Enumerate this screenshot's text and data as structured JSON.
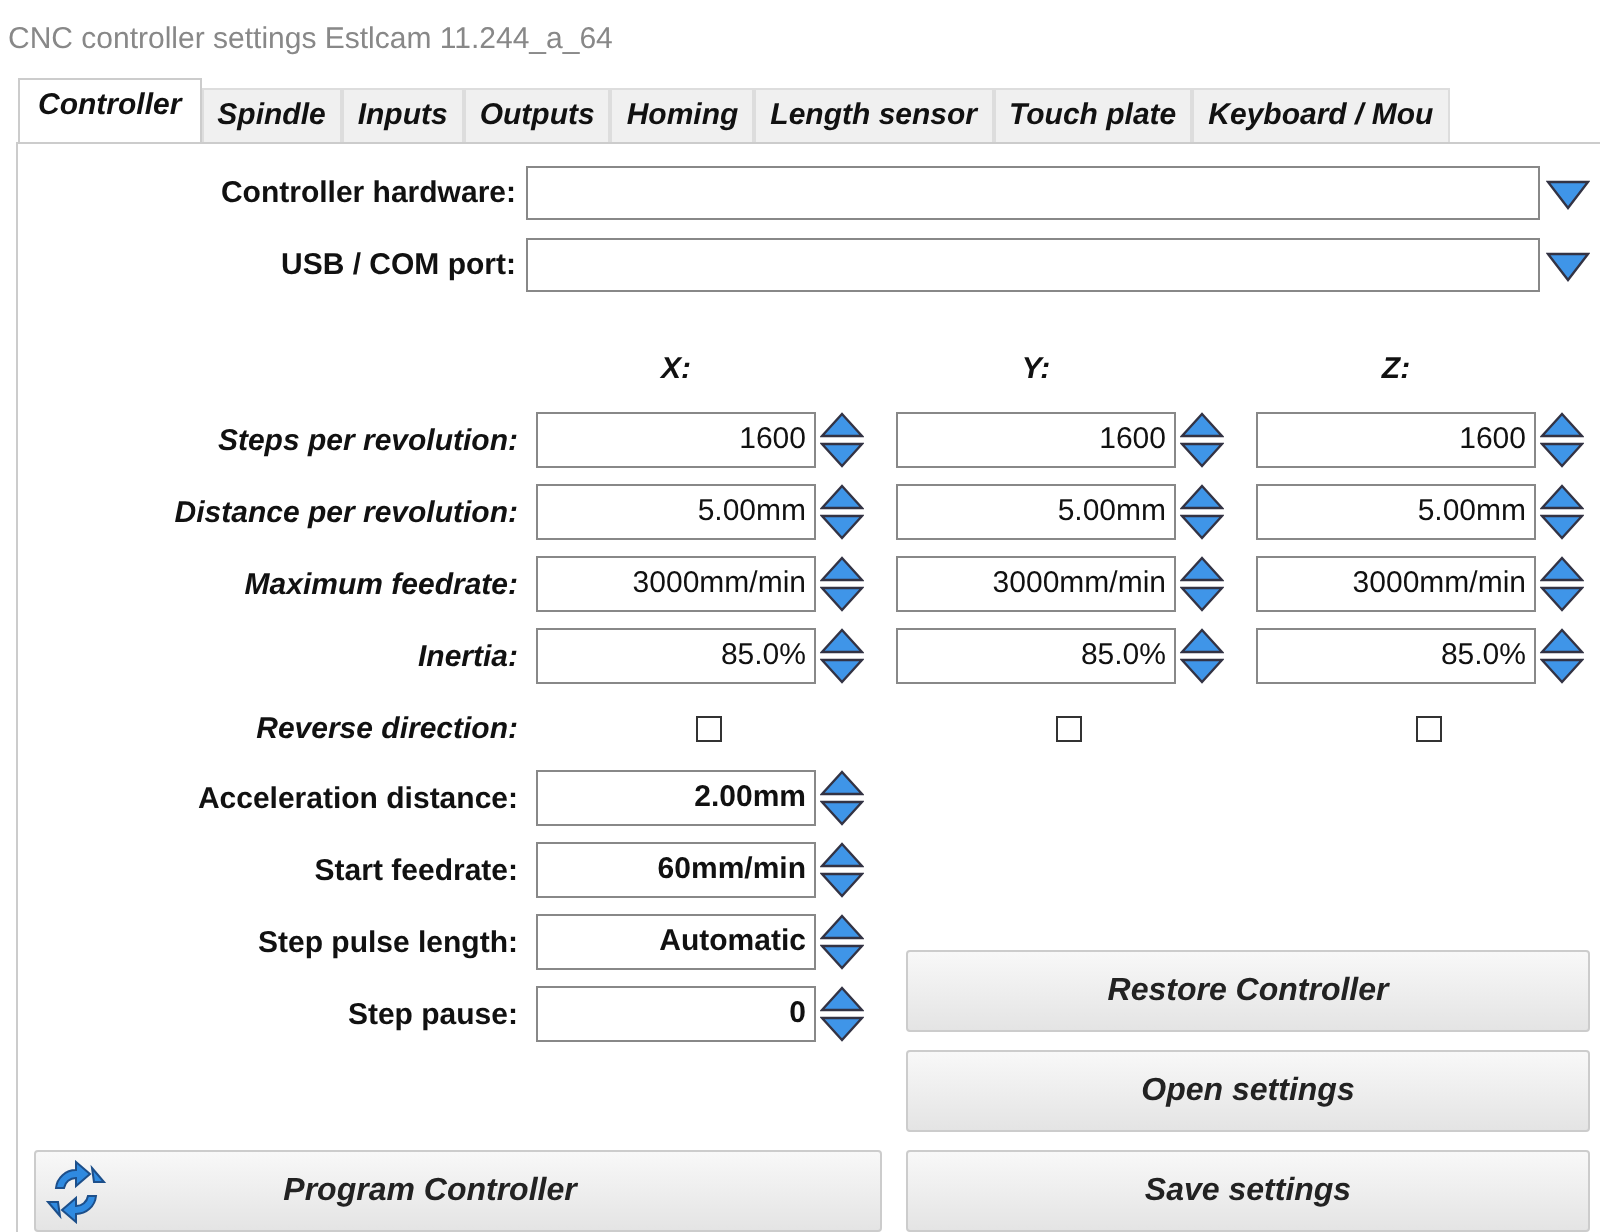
{
  "window": {
    "title": "CNC controller settings Estlcam 11.244_a_64"
  },
  "tabs": [
    {
      "label": "Controller",
      "selected": true
    },
    {
      "label": "Spindle",
      "selected": false
    },
    {
      "label": "Inputs",
      "selected": false
    },
    {
      "label": "Outputs",
      "selected": false
    },
    {
      "label": "Homing",
      "selected": false
    },
    {
      "label": "Length sensor",
      "selected": false
    },
    {
      "label": "Touch plate",
      "selected": false
    },
    {
      "label": "Keyboard / Mou",
      "selected": false
    }
  ],
  "dropdowns": [
    {
      "label": "Controller hardware:"
    },
    {
      "label": "USB / COM port:"
    }
  ],
  "axis_headers": [
    "X:",
    "Y:",
    "Z:"
  ],
  "axis_rows": [
    {
      "label": "Steps per revolution:",
      "values": [
        "1600",
        "1600",
        "1600"
      ]
    },
    {
      "label": "Distance per revolution:",
      "values": [
        "5.00mm",
        "5.00mm",
        "5.00mm"
      ]
    },
    {
      "label": "Maximum feedrate:",
      "values": [
        "3000mm/min",
        "3000mm/min",
        "3000mm/min"
      ]
    },
    {
      "label": "Inertia:",
      "values": [
        "85.0%",
        "85.0%",
        "85.0%"
      ]
    }
  ],
  "reverse_direction": {
    "label": "Reverse direction:",
    "axes": [
      {
        "checked": false
      },
      {
        "checked": false
      },
      {
        "checked": false
      }
    ]
  },
  "params": [
    {
      "label": "Acceleration distance:",
      "value": "2.00mm"
    },
    {
      "label": "Start feedrate:",
      "value": "60mm/min"
    },
    {
      "label": "Step pulse length:",
      "value": "Automatic"
    },
    {
      "label": "Step pause:",
      "value": "0"
    }
  ],
  "side_buttons": [
    "Restore Controller",
    "Open settings",
    "Save settings"
  ],
  "program_button": {
    "label": "Program Controller"
  }
}
